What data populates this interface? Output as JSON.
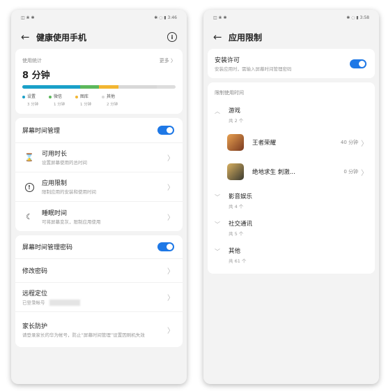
{
  "left": {
    "status_left": "◫ ❀ ✱",
    "status_right": "✱ ◌ ▮ 3:46",
    "title": "健康使用手机",
    "usage_label": "使用统计",
    "usage_more": "更多 〉",
    "usage_total": "8 分钟",
    "usage_segments": [
      {
        "name": "设置",
        "time": "3 分钟",
        "color": "#1aa0c8",
        "fraction": 0.375
      },
      {
        "name": "微信",
        "time": "1 分钟",
        "color": "#5cb85c",
        "fraction": 0.125
      },
      {
        "name": "图库",
        "time": "1 分钟",
        "color": "#f2b632",
        "fraction": 0.125
      },
      {
        "name": "其他",
        "time": "2 分钟",
        "color": "#d8d8d8",
        "fraction": 0.25
      }
    ],
    "screen_time_label": "屏幕时间管理",
    "screen_time_enabled": true,
    "items": [
      {
        "label": "可用时长",
        "sub": "设置屏幕使用的总时间",
        "icon": "⌛"
      },
      {
        "label": "应用限制",
        "sub": "限制应用的安装和使用时间",
        "icon": "!"
      },
      {
        "label": "睡眠时间",
        "sub": "可将屏幕变灰，限制应用使用",
        "icon": "☾"
      }
    ],
    "password_label": "屏幕时间管理密码",
    "password_enabled": true,
    "change_password": "修改密码",
    "remote_location": "远程定位",
    "remote_sub": "已登录帐号",
    "parent_protection": "家长防护",
    "parent_sub": "请登录家长的华为帐号，防止“屏幕时间管理”设置因刷机失效"
  },
  "right": {
    "status_left": "◫ ❀ ✱",
    "status_right": "✱ ◌ ▮ 3:58",
    "title": "应用限制",
    "install_label": "安装许可",
    "install_sub": "安装应用时，需输入屏幕时间管理密码",
    "install_enabled": true,
    "section_title": "限制使用时间",
    "games_label": "游戏",
    "games_count": "共 2 个",
    "apps": [
      {
        "name": "王者荣耀",
        "time": "40 分钟",
        "color": "#c0703a"
      },
      {
        "name": "绝地求生 刺激...",
        "time": "0 分钟",
        "color": "#b08a3c"
      }
    ],
    "groups": [
      {
        "label": "影音娱乐",
        "count": "共 4 个"
      },
      {
        "label": "社交通讯",
        "count": "共 5 个"
      },
      {
        "label": "其他",
        "count": "共 61 个"
      }
    ]
  }
}
